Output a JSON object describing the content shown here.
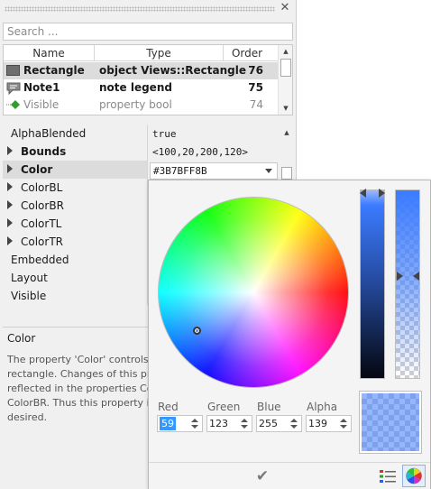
{
  "search": {
    "placeholder": "Search ..."
  },
  "objects": {
    "columns": [
      "Name",
      "Type",
      "Order"
    ],
    "rows": [
      {
        "icon": "rectangle-icon",
        "name": "Rectangle",
        "type": "object Views::Rectangle",
        "order": "76"
      },
      {
        "icon": "note-icon",
        "name": "Note1",
        "type": "note legend",
        "order": "75"
      },
      {
        "icon": "property-icon",
        "name": "Visible",
        "type": "property bool",
        "order": "74"
      }
    ]
  },
  "properties": {
    "rows": [
      {
        "name": "AlphaBlended",
        "value": "true"
      },
      {
        "name": "Bounds",
        "value": "<100,20,200,120>"
      },
      {
        "name": "Color",
        "value": "#3B7BFF8B"
      },
      {
        "name": "ColorBL"
      },
      {
        "name": "ColorBR"
      },
      {
        "name": "ColorTL"
      },
      {
        "name": "ColorTR"
      },
      {
        "name": "Embedded"
      },
      {
        "name": "Layout"
      },
      {
        "name": "Visible"
      }
    ]
  },
  "description": {
    "title": "Color",
    "lines": [
      "The property 'Color' controls t",
      "rectangle. Changes of this pro",
      "reflected in the properties Colo",
      "ColorBR. Thus this property is",
      "desired."
    ]
  },
  "picker": {
    "channels": [
      {
        "label": "Red",
        "value": "59"
      },
      {
        "label": "Green",
        "value": "123"
      },
      {
        "label": "Blue",
        "value": "255"
      },
      {
        "label": "Alpha",
        "value": "139"
      }
    ],
    "current_color": "#3B7BFF",
    "accent": "#3399ff",
    "ok_icon": "checkmark-icon",
    "modes": [
      "color-list-icon",
      "color-wheel-icon"
    ]
  }
}
